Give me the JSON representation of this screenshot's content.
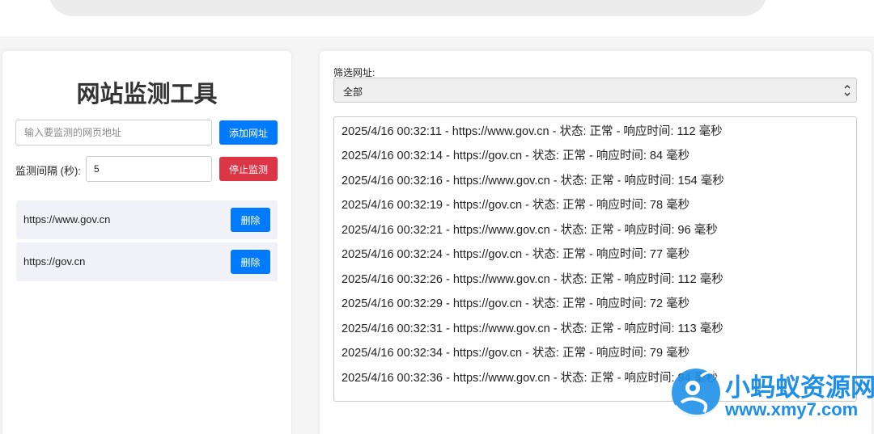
{
  "sidebar": {
    "title": "网站监测工具",
    "url_input_placeholder": "输入要监测的网页地址",
    "add_button": "添加网址",
    "interval_label": "监测间隔 (秒):",
    "interval_value": "5",
    "stop_button": "停止监测",
    "sites": [
      {
        "url": "https://www.gov.cn",
        "delete_label": "删除"
      },
      {
        "url": "https://gov.cn",
        "delete_label": "删除"
      }
    ]
  },
  "main": {
    "filter_label": "筛选网址:",
    "filter_value": "全部",
    "log": [
      "2025/4/16 00:32:11 - https://www.gov.cn - 状态: 正常 - 响应时间: 112 毫秒",
      "2025/4/16 00:32:14 - https://gov.cn - 状态: 正常 - 响应时间: 84 毫秒",
      "2025/4/16 00:32:16 - https://www.gov.cn - 状态: 正常 - 响应时间: 154 毫秒",
      "2025/4/16 00:32:19 - https://gov.cn - 状态: 正常 - 响应时间: 78 毫秒",
      "2025/4/16 00:32:21 - https://www.gov.cn - 状态: 正常 - 响应时间: 96 毫秒",
      "2025/4/16 00:32:24 - https://gov.cn - 状态: 正常 - 响应时间: 77 毫秒",
      "2025/4/16 00:32:26 - https://www.gov.cn - 状态: 正常 - 响应时间: 112 毫秒",
      "2025/4/16 00:32:29 - https://gov.cn - 状态: 正常 - 响应时间: 72 毫秒",
      "2025/4/16 00:32:31 - https://www.gov.cn - 状态: 正常 - 响应时间: 113 毫秒",
      "2025/4/16 00:32:34 - https://gov.cn - 状态: 正常 - 响应时间: 79 毫秒",
      "2025/4/16 00:32:36 - https://www.gov.cn - 状态: 正常 - 响应时间: 94 毫秒"
    ]
  },
  "watermark": {
    "title": "小蚂蚁资源网",
    "url": "www.xmy7.com"
  },
  "colors": {
    "primary": "#007bff",
    "danger": "#dc3545",
    "watermark": "#1e8fe8"
  },
  "icons": {
    "filter_chevron": "chevron-down-icon",
    "watermark_logo": "ant-logo-icon"
  }
}
